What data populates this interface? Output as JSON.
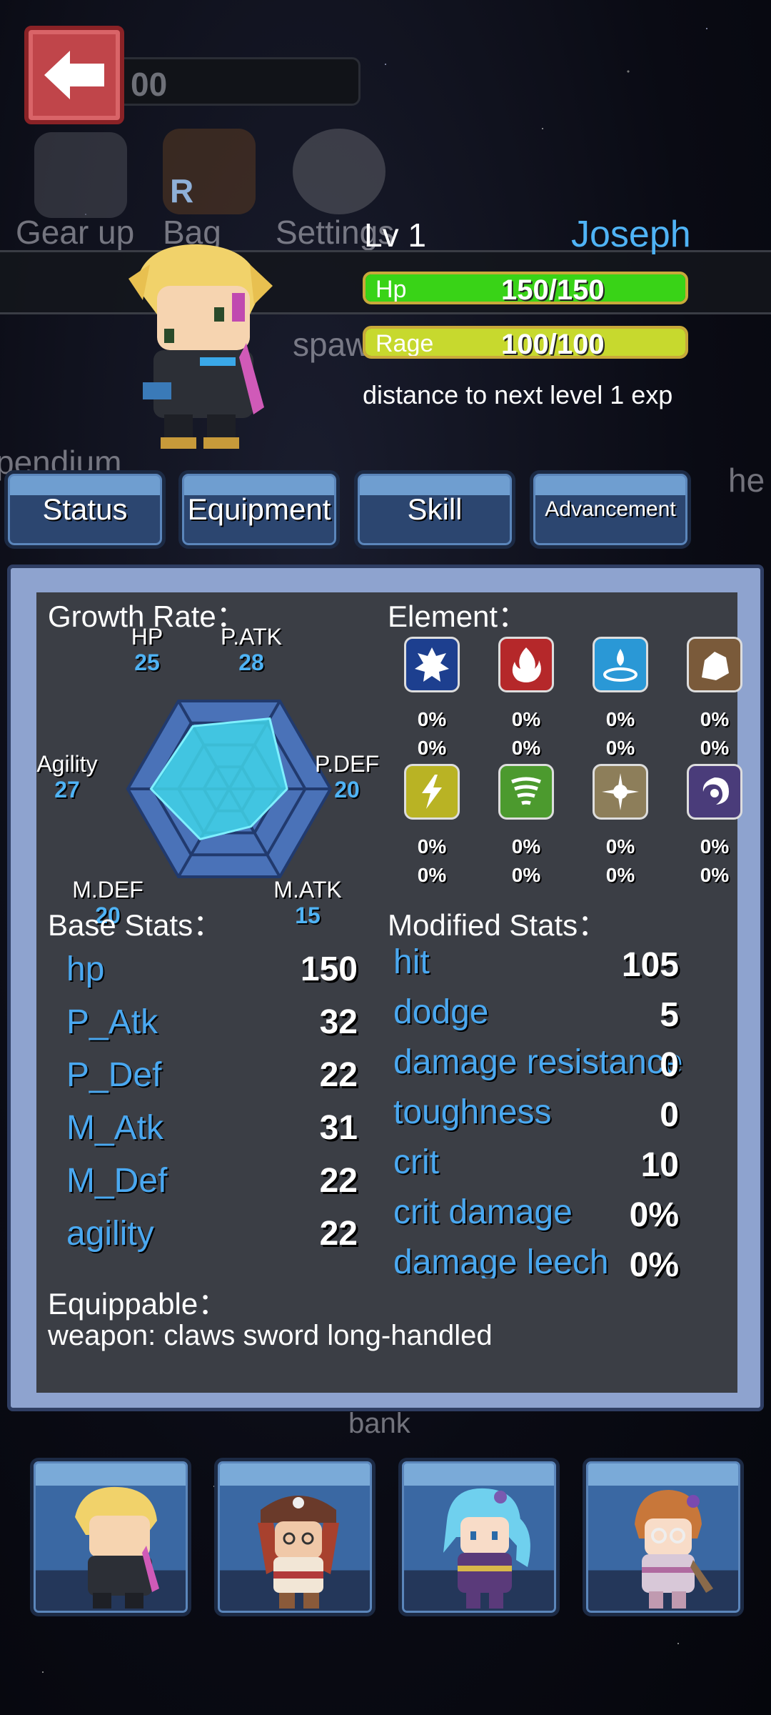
{
  "background_hud": {
    "gold_value": "00",
    "menu_labels": [
      "Gear up",
      "Bag",
      "Settings"
    ],
    "bag_badge": "R",
    "spawn_label": "spaw",
    "left_label": "pendium",
    "right_label": "he",
    "bank_label": "bank"
  },
  "hero": {
    "level": "Lv 1",
    "name": "Joseph",
    "hp": {
      "label": "Hp",
      "value": "150/150",
      "fraction": 1.0,
      "color": "#39d317"
    },
    "rage": {
      "label": "Rage",
      "value": "100/100",
      "fraction": 1.0,
      "color": "#c7d92e"
    },
    "exp_text": "distance to next level 1 exp"
  },
  "tabs": [
    "Status",
    "Equipment",
    "Skill",
    "Advancement"
  ],
  "panel": {
    "growth_title": "Growth Rate：",
    "growth": [
      {
        "label": "HP",
        "value": "25",
        "v": 25
      },
      {
        "label": "P.ATK",
        "value": "28",
        "v": 28
      },
      {
        "label": "P.DEF",
        "value": "20",
        "v": 20
      },
      {
        "label": "M.ATK",
        "value": "15",
        "v": 15
      },
      {
        "label": "M.DEF",
        "value": "20",
        "v": 20
      },
      {
        "label": "Agility",
        "value": "27",
        "v": 27
      }
    ],
    "element_title": "Element：",
    "elements": [
      {
        "icon": "ice-icon",
        "bg": "#1d3f8f",
        "atk": "0%",
        "def": "0%"
      },
      {
        "icon": "fire-icon",
        "bg": "#b5282a",
        "atk": "0%",
        "def": "0%"
      },
      {
        "icon": "water-icon",
        "bg": "#2a98d6",
        "atk": "0%",
        "def": "0%"
      },
      {
        "icon": "earth-icon",
        "bg": "#7a5a3a",
        "atk": "0%",
        "def": "0%"
      },
      {
        "icon": "lightning-icon",
        "bg": "#b9b324",
        "atk": "0%",
        "def": "0%"
      },
      {
        "icon": "wind-icon",
        "bg": "#4c9a2e",
        "atk": "0%",
        "def": "0%"
      },
      {
        "icon": "light-icon",
        "bg": "#8d7e5a",
        "atk": "0%",
        "def": "0%"
      },
      {
        "icon": "dark-icon",
        "bg": "#4a3c7a",
        "atk": "0%",
        "def": "0%"
      }
    ],
    "base_title": "Base Stats：",
    "base_stats": [
      {
        "name": "hp",
        "value": "150"
      },
      {
        "name": "P_Atk",
        "value": "32"
      },
      {
        "name": "P_Def",
        "value": "22"
      },
      {
        "name": "M_Atk",
        "value": "31"
      },
      {
        "name": "M_Def",
        "value": "22"
      },
      {
        "name": "agility",
        "value": "22"
      }
    ],
    "modified_title": "Modified Stats：",
    "modified_stats": [
      {
        "name": "hit",
        "value": "105"
      },
      {
        "name": "dodge",
        "value": "5"
      },
      {
        "name": "damage resistance",
        "value": "0"
      },
      {
        "name": "toughness",
        "value": "0"
      },
      {
        "name": "crit",
        "value": "10"
      },
      {
        "name": "crit damage",
        "value": "0%"
      },
      {
        "name": "damage leech",
        "value": "0%"
      }
    ],
    "equip_title": "Equippable：",
    "equip_text": "weapon: claws sword long-handled"
  },
  "team": [
    "team-member-joseph",
    "team-member-pirate",
    "team-member-mage",
    "team-member-scholar"
  ]
}
